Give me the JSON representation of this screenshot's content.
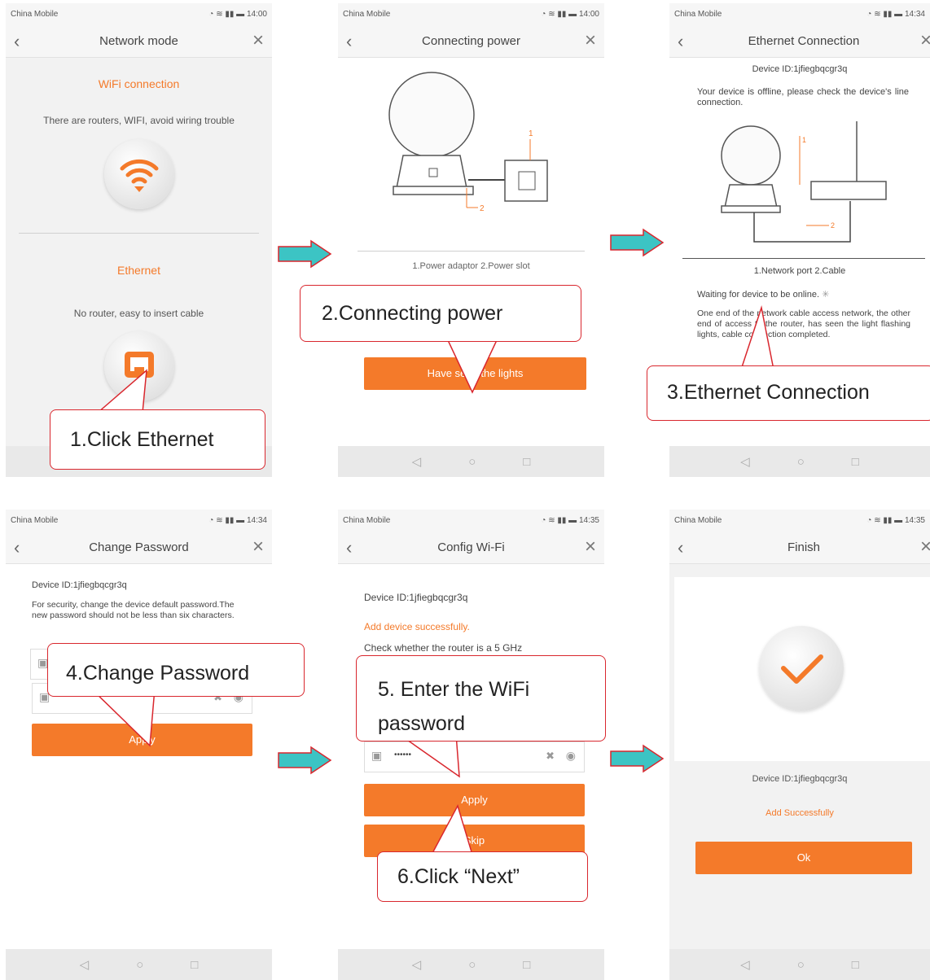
{
  "status": {
    "carrier": "China Mobile",
    "time_1": "14:00",
    "time_2": "14:00",
    "time_3": "14:34",
    "time_4": "14:34",
    "time_5": "14:35",
    "time_6": "14:35"
  },
  "screen1": {
    "title": "Network mode",
    "wifi_heading": "WiFi connection",
    "wifi_desc": "There are routers, WIFI, avoid wiring trouble",
    "eth_heading": "Ethernet",
    "eth_desc": "No router, easy to insert cable",
    "callout": "1.Click Ethernet"
  },
  "screen2": {
    "title": "Connecting power",
    "caption": "1.Power adaptor 2.Power slot",
    "button": "Have seen the lights",
    "label_1": "1",
    "label_2": "2",
    "callout": "2.Connecting power"
  },
  "screen3": {
    "title": "Ethernet Connection",
    "device_id": "Device ID:1jfiegbqcgr3q",
    "offline_msg": "Your device is offline, please check the device's line connection.",
    "caption": "1.Network port 2.Cable",
    "waiting": "Waiting for device to be online.",
    "instruction": "One end of the network cable access network, the other end of access to the router, has seen the light flashing lights, cable connection completed.",
    "label_1": "1",
    "label_2": "2",
    "callout": "3.Ethernet Connection"
  },
  "screen4": {
    "title": "Change Password",
    "device_id": "Device ID:1jfiegbqcgr3q",
    "security_msg": "For security, change the device default password.The new password should not be less than six characters.",
    "password_mask": "••••••",
    "button": "Apply",
    "callout": "4.Change Password"
  },
  "screen5": {
    "title": "Config Wi-Fi",
    "device_id": "Device ID:1jfiegbqcgr3q",
    "success": "Add device successfully.",
    "check": "Check whether the router is a 5 GHz",
    "password_mask": "••••••",
    "apply": "Apply",
    "skip": "Skip",
    "callout_wifi": "5. Enter the WiFi password",
    "callout_next": "6.Click “Next”"
  },
  "screen6": {
    "title": "Finish",
    "device_id": "Device ID:1jfiegbqcgr3q",
    "success": "Add Successfully",
    "button": "Ok"
  },
  "colors": {
    "accent": "#f47a2a",
    "arrow_fill": "#3cc4c4",
    "callout_border": "#d9272e"
  },
  "icons": [
    "back-icon",
    "close-icon",
    "wifi-icon",
    "ethernet-icon",
    "right-arrow-icon",
    "checkmark-icon",
    "eye-icon",
    "clear-icon",
    "lock-icon",
    "camera-icon"
  ]
}
